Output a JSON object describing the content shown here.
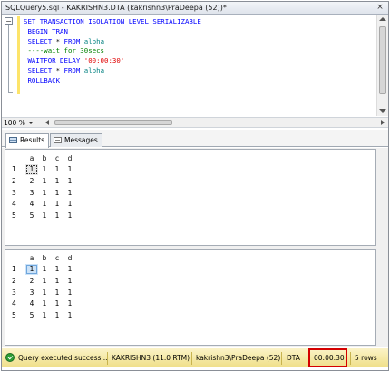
{
  "window": {
    "title": "SQLQuery5.sql - KAKRISHN3.DTA (kakrishn3\\PraDeepa (52))*",
    "close_glyph": "×"
  },
  "editor": {
    "lines": [
      [
        {
          "t": "SET TRANSACTION ISOLATION LEVEL SERIALIZABLE",
          "c": "kw"
        }
      ],
      [
        {
          "t": " BEGIN TRAN",
          "c": "kw"
        }
      ],
      [
        {
          "t": " SELECT ",
          "c": "kw"
        },
        {
          "t": "* ",
          "c": ""
        },
        {
          "t": "FROM ",
          "c": "kw"
        },
        {
          "t": "alpha",
          "c": "id"
        }
      ],
      [
        {
          "t": " ----wait for 30secs",
          "c": "cm"
        }
      ],
      [
        {
          "t": " WAITFOR DELAY ",
          "c": "kw"
        },
        {
          "t": "'00:00:30'",
          "c": "st"
        }
      ],
      [
        {
          "t": " SELECT ",
          "c": "kw"
        },
        {
          "t": "* ",
          "c": ""
        },
        {
          "t": "FROM ",
          "c": "kw"
        },
        {
          "t": "alpha",
          "c": "id"
        }
      ],
      [
        {
          "t": " ROLLBACK",
          "c": "kw"
        }
      ]
    ],
    "collapse_glyph": "−"
  },
  "zoom": {
    "value": "100 %"
  },
  "tabs": {
    "results": "Results",
    "messages": "Messages"
  },
  "grid1": {
    "columns": [
      "a",
      "b",
      "c",
      "d"
    ],
    "rows": [
      [
        "1",
        "1",
        "1",
        "1",
        "1"
      ],
      [
        "2",
        "2",
        "1",
        "1",
        "1"
      ],
      [
        "3",
        "3",
        "1",
        "1",
        "1"
      ],
      [
        "4",
        "4",
        "1",
        "1",
        "1"
      ],
      [
        "5",
        "5",
        "1",
        "1",
        "1"
      ]
    ]
  },
  "grid2": {
    "columns": [
      "a",
      "b",
      "c",
      "d"
    ],
    "rows": [
      [
        "1",
        "1",
        "1",
        "1",
        "1"
      ],
      [
        "2",
        "2",
        "1",
        "1",
        "1"
      ],
      [
        "3",
        "3",
        "1",
        "1",
        "1"
      ],
      [
        "4",
        "4",
        "1",
        "1",
        "1"
      ],
      [
        "5",
        "5",
        "1",
        "1",
        "1"
      ]
    ]
  },
  "status": {
    "message": "Query executed success...",
    "server": "KAKRISHN3 (11.0 RTM)",
    "user": "kakrishn3\\PraDeepa (52)",
    "database": "DTA",
    "elapsed": "00:00:30",
    "rows": "5 rows",
    "highlight_color": "#d40000"
  }
}
